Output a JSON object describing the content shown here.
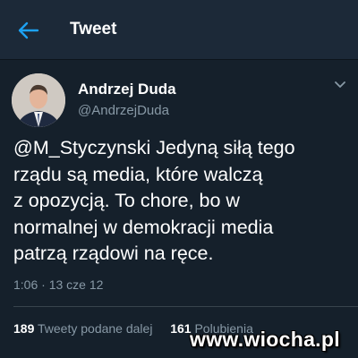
{
  "header": {
    "title": "Tweet",
    "back_icon": "arrow-left-icon",
    "accent": "#1da1f2"
  },
  "tweet": {
    "author_name": "Andrzej Duda",
    "author_handle": "@AndrzejDuda",
    "text_lines": [
      "@M_Styczynski Jedyną siłą tego",
      "rządu są media, które walczą",
      "z opozycją. To chore, bo w",
      "normalnej w demokracji media",
      "patrzą rządowi na ręce."
    ],
    "meta": "1:06 · 13 cze 12",
    "more_icon": "chevron-down-icon"
  },
  "stats": {
    "retweets_count": "189",
    "retweets_label": "Tweety podane dalej",
    "likes_count": "161",
    "likes_label": "Polubienia"
  },
  "watermark": "www.wiocha.pl",
  "colors": {
    "background": "#15202b",
    "header_background": "#1c2938",
    "secondary_text": "#8899a6"
  }
}
